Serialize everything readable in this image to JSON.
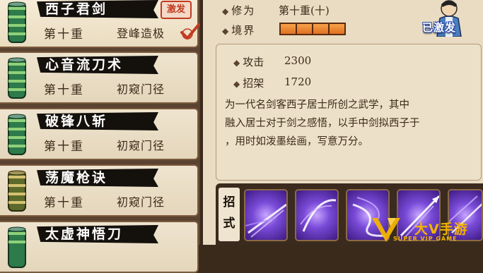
{
  "skills": [
    {
      "name": "西子君剑",
      "level": "第十重",
      "rank": "登峰造极",
      "badge": "激发",
      "selected": true
    },
    {
      "name": "心音流刀术",
      "level": "第十重",
      "rank": "初窥门径",
      "selected": false
    },
    {
      "name": "破锋八斩",
      "level": "第十重",
      "rank": "初窥门径",
      "selected": false
    },
    {
      "name": "荡魔枪诀",
      "level": "第十重",
      "rank": "初窥门径",
      "selected": false
    },
    {
      "name": "太虚神悟刀",
      "selected": false
    }
  ],
  "detail": {
    "cultivation_label": "修为",
    "cultivation_value": "第十重(十)",
    "realm_label": "境界",
    "realm_segments_filled": 4,
    "realm_segments_total": 4,
    "activated_label": "已激发",
    "attack_label": "攻击",
    "attack_value": "2300",
    "parry_label": "招架",
    "parry_value": "1720",
    "description": "为一代名剑客西子居士所创之武学，其中\n融入居士对于剑之感悟，以手中剑拟西子于\n，用时如泼墨绘画，写意万分。"
  },
  "moves": {
    "label": "招式",
    "slots": [
      "move-1",
      "move-2",
      "move-3",
      "move-4",
      "move-5"
    ]
  },
  "watermark": {
    "text": "大V手游",
    "sub": "SUPER VIP GAME"
  },
  "colors": {
    "accent_red": "#c23b22",
    "realm_orange": "#e07020",
    "panel_bg": "#e9dcc2",
    "watermark_gold": "#f4b400"
  }
}
